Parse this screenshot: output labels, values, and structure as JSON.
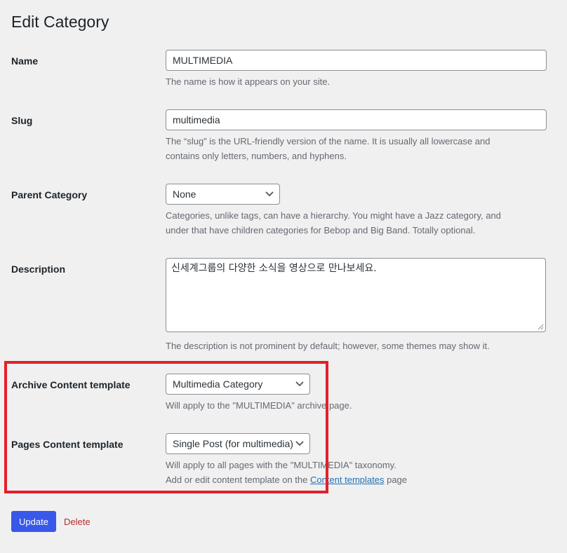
{
  "page": {
    "title": "Edit Category"
  },
  "fields": {
    "name": {
      "label": "Name",
      "value": "MULTIMEDIA",
      "help": "The name is how it appears on your site."
    },
    "slug": {
      "label": "Slug",
      "value": "multimedia",
      "help_line1": "The “slug” is the URL-friendly version of the name. It is usually all lowercase and",
      "help_line2": "contains only letters, numbers, and hyphens."
    },
    "parent": {
      "label": "Parent Category",
      "selected": "None",
      "help_line1": "Categories, unlike tags, can have a hierarchy. You might have a Jazz category, and",
      "help_line2": "under that have children categories for Bebop and Big Band. Totally optional."
    },
    "description": {
      "label": "Description",
      "value": "신세계그룹의 다양한 소식을 영상으로 만나보세요.",
      "help": "The description is not prominent by default; however, some themes may show it."
    },
    "archive_template": {
      "label": "Archive Content template",
      "selected": "Multimedia Category",
      "help": "Will apply to the \"MULTIMEDIA\" archive page."
    },
    "pages_template": {
      "label": "Pages Content template",
      "selected": "Single Post (for multimedia)",
      "help_line1": "Will apply to all pages with the \"MULTIMEDIA\" taxonomy.",
      "help_prefix": "Add or edit content template on the ",
      "help_link": "Content templates",
      "help_suffix": " page"
    }
  },
  "actions": {
    "update_label": "Update",
    "delete_label": "Delete"
  },
  "colors": {
    "background": "#f0f0f1",
    "primary_button": "#3858e9",
    "delete_link": "#b32d2e",
    "highlight": "#e3202b",
    "link": "#2271b1"
  },
  "icons": {
    "select_arrow": "chevron-down-icon",
    "textarea_resize": "resize-handle-icon"
  }
}
